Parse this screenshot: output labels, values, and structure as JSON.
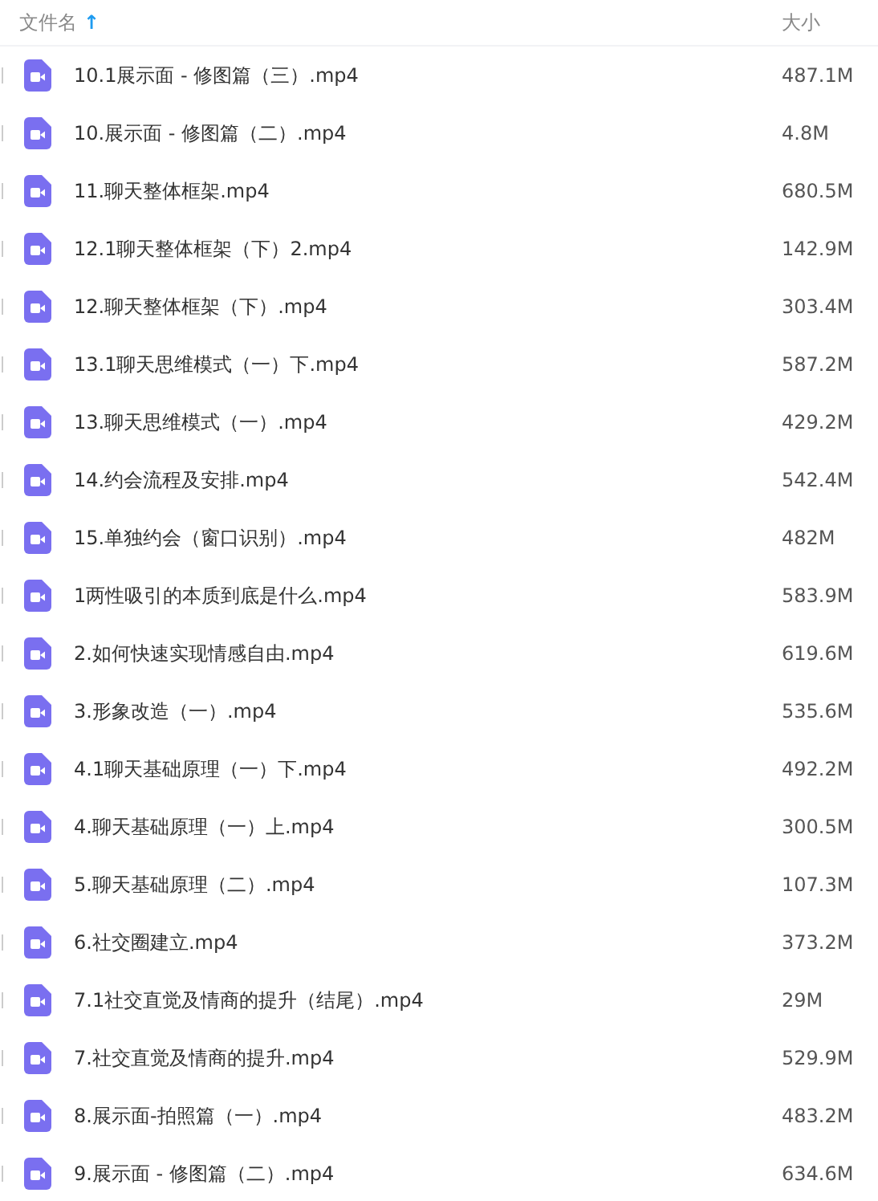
{
  "columns": [
    {
      "label": "文件名",
      "sort_arrow": "↑"
    },
    {
      "label": "大小"
    }
  ],
  "files": [
    {
      "name": "10.1展示面 - 修图篇（三）.mp4",
      "size": "487.1M"
    },
    {
      "name": "10.展示面 - 修图篇（二）.mp4",
      "size": "4.8M"
    },
    {
      "name": "11.聊天整体框架.mp4",
      "size": "680.5M"
    },
    {
      "name": "12.1聊天整体框架（下）2.mp4",
      "size": "142.9M"
    },
    {
      "name": "12.聊天整体框架（下）.mp4",
      "size": "303.4M"
    },
    {
      "name": "13.1聊天思维模式（一）下.mp4",
      "size": "587.2M"
    },
    {
      "name": "13.聊天思维模式（一）.mp4",
      "size": "429.2M"
    },
    {
      "name": "14.约会流程及安排.mp4",
      "size": "542.4M"
    },
    {
      "name": "15.单独约会（窗口识别）.mp4",
      "size": "482M"
    },
    {
      "name": "1两性吸引的本质到底是什么.mp4",
      "size": "583.9M"
    },
    {
      "name": "2.如何快速实现情感自由.mp4",
      "size": "619.6M"
    },
    {
      "name": "3.形象改造（一）.mp4",
      "size": "535.6M"
    },
    {
      "name": "4.1聊天基础原理（一）下.mp4",
      "size": "492.2M"
    },
    {
      "name": "4.聊天基础原理（一）上.mp4",
      "size": "300.5M"
    },
    {
      "name": "5.聊天基础原理（二）.mp4",
      "size": "107.3M"
    },
    {
      "name": "6.社交圈建立.mp4",
      "size": "373.2M"
    },
    {
      "name": "7.1社交直觉及情商的提升（结尾）.mp4",
      "size": "29M"
    },
    {
      "name": "7.社交直觉及情商的提升.mp4",
      "size": "529.9M"
    },
    {
      "name": "8.展示面-拍照篇（一）.mp4",
      "size": "483.2M"
    },
    {
      "name": "9.展示面 - 修图篇（二）.mp4",
      "size": "634.6M"
    }
  ]
}
